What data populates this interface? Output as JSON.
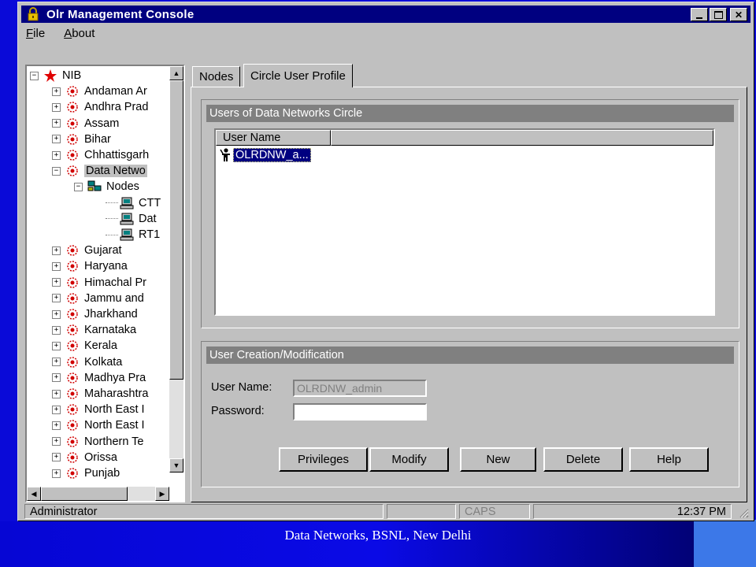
{
  "window": {
    "title": "Olr Management Console"
  },
  "menu": [
    {
      "label": "File",
      "accel": "F",
      "rest": "ile"
    },
    {
      "label": "About",
      "accel": "A",
      "rest": "bout"
    }
  ],
  "tree": {
    "root": "NIB",
    "items": [
      {
        "label": "Andaman Ar",
        "toggle": "+",
        "level": 1,
        "icon": "circle-node-icon"
      },
      {
        "label": "Andhra Prad",
        "toggle": "+",
        "level": 1,
        "icon": "circle-node-icon"
      },
      {
        "label": "Assam",
        "toggle": "+",
        "level": 1,
        "icon": "circle-node-icon"
      },
      {
        "label": "Bihar",
        "toggle": "+",
        "level": 1,
        "icon": "circle-node-icon"
      },
      {
        "label": "Chhattisgarh",
        "toggle": "+",
        "level": 1,
        "icon": "circle-node-icon"
      },
      {
        "label": "Data Netwo",
        "toggle": "−",
        "level": 1,
        "icon": "circle-node-icon",
        "selected": true
      },
      {
        "label": "Nodes",
        "toggle": "−",
        "level": 2,
        "icon": "nodes-icon"
      },
      {
        "label": "CTT",
        "toggle": "",
        "level": 3,
        "icon": "computer-icon"
      },
      {
        "label": "Dat",
        "toggle": "",
        "level": 3,
        "icon": "computer-icon"
      },
      {
        "label": "RT1",
        "toggle": "",
        "level": 3,
        "icon": "computer-icon"
      },
      {
        "label": "Gujarat",
        "toggle": "+",
        "level": 1,
        "icon": "circle-node-icon"
      },
      {
        "label": "Haryana",
        "toggle": "+",
        "level": 1,
        "icon": "circle-node-icon"
      },
      {
        "label": "Himachal Pr",
        "toggle": "+",
        "level": 1,
        "icon": "circle-node-icon"
      },
      {
        "label": "Jammu and",
        "toggle": "+",
        "level": 1,
        "icon": "circle-node-icon"
      },
      {
        "label": "Jharkhand",
        "toggle": "+",
        "level": 1,
        "icon": "circle-node-icon"
      },
      {
        "label": "Karnataka",
        "toggle": "+",
        "level": 1,
        "icon": "circle-node-icon"
      },
      {
        "label": "Kerala",
        "toggle": "+",
        "level": 1,
        "icon": "circle-node-icon"
      },
      {
        "label": "Kolkata",
        "toggle": "+",
        "level": 1,
        "icon": "circle-node-icon"
      },
      {
        "label": "Madhya Pra",
        "toggle": "+",
        "level": 1,
        "icon": "circle-node-icon"
      },
      {
        "label": "Maharashtra",
        "toggle": "+",
        "level": 1,
        "icon": "circle-node-icon"
      },
      {
        "label": "North East I",
        "toggle": "+",
        "level": 1,
        "icon": "circle-node-icon"
      },
      {
        "label": "North East I",
        "toggle": "+",
        "level": 1,
        "icon": "circle-node-icon"
      },
      {
        "label": "Northern Te",
        "toggle": "+",
        "level": 1,
        "icon": "circle-node-icon"
      },
      {
        "label": "Orissa",
        "toggle": "+",
        "level": 1,
        "icon": "circle-node-icon"
      },
      {
        "label": "Punjab",
        "toggle": "+",
        "level": 1,
        "icon": "circle-node-icon"
      }
    ]
  },
  "tabs": [
    {
      "label": "Nodes",
      "active": false
    },
    {
      "label": "Circle User Profile",
      "active": true
    }
  ],
  "users_group": {
    "header": "Users of Data Networks Circle",
    "column_header": "User Name",
    "items": [
      {
        "label": "OLRDNW_a...",
        "selected": true
      }
    ]
  },
  "creation_group": {
    "header": "User Creation/Modification",
    "username_label": "User Name:",
    "username_value": "OLRDNW_admin",
    "password_label": "Password:",
    "password_value": ""
  },
  "buttons": {
    "privileges": "Privileges",
    "modify": "Modify",
    "new": "New",
    "delete": "Delete",
    "help": "Help"
  },
  "status": {
    "user": "Administrator",
    "caps": "CAPS",
    "time": "12:37 PM"
  },
  "footer": {
    "text": "Data Networks, BSNL, New Delhi"
  },
  "colors": {
    "titlebar": "#000080",
    "window_face": "#c0c0c0",
    "selection": "#000080",
    "slide_background": "#0a0ad8"
  }
}
